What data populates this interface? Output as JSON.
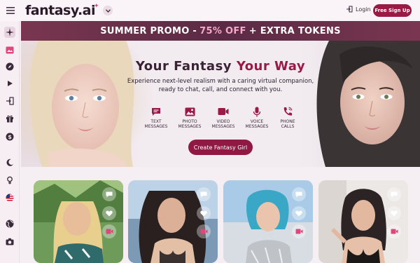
{
  "header": {
    "logo": "fantasy.ai",
    "login_label": "Login",
    "signup_label": "Free Sign Up"
  },
  "promo": {
    "text_start": "SUMMER PROMO -",
    "highlight": "75% OFF",
    "text_end": "+ EXTRA TOKENS"
  },
  "hero": {
    "title_start": "Your Fantasy",
    "title_accent": "Your Way",
    "description": "Experience next-level realism with a caring virtual companion, ready to chat, call, and connect with you.",
    "features": [
      {
        "icon": "text-message-icon",
        "line1": "TEXT",
        "line2": "MESSAGES"
      },
      {
        "icon": "photo-icon",
        "line1": "PHOTO",
        "line2": "MESSAGES"
      },
      {
        "icon": "video-icon",
        "line1": "VIDEO",
        "line2": "MESSAGES"
      },
      {
        "icon": "microphone-icon",
        "line1": "VOICE",
        "line2": "MESSAGES"
      },
      {
        "icon": "phone-icon",
        "line1": "PHONE",
        "line2": "CALLS"
      }
    ],
    "cta_label": "Create Fantasy Girl"
  },
  "colors": {
    "accent": "#9b1a45",
    "promo_bg": "#6a2e48",
    "promo_highlight": "#f6a9c9"
  },
  "sidebar": {
    "icons": [
      "sparkle-icon",
      "gallery-icon",
      "compass-icon",
      "play-icon",
      "login-icon",
      "gift-icon",
      "dollar-icon",
      "moon-icon",
      "gender-icon",
      "us-flag-icon",
      "globe-icon",
      "camera-icon"
    ]
  }
}
